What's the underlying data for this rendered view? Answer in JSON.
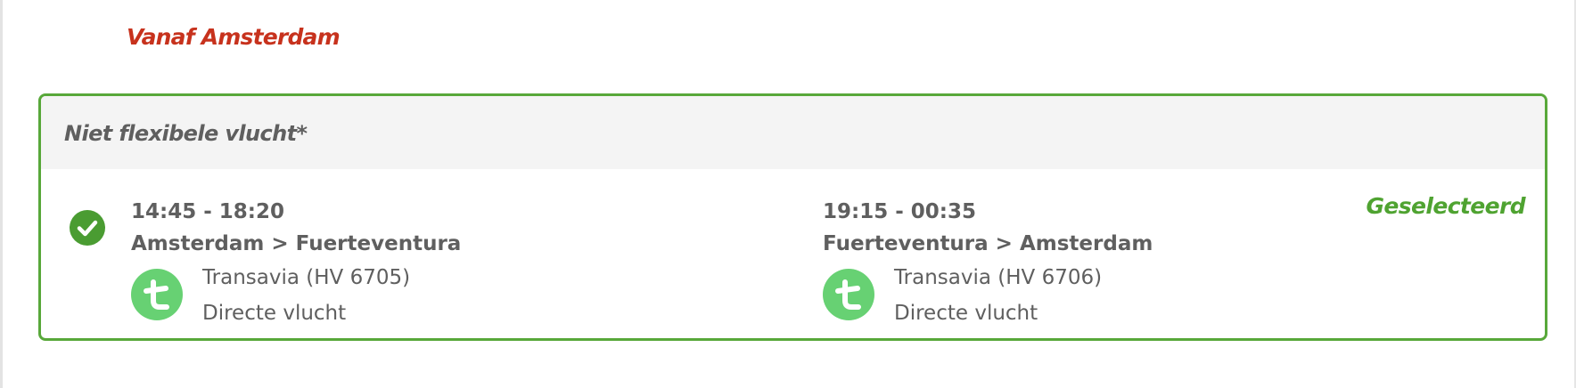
{
  "section": {
    "title": "Vanaf Amsterdam"
  },
  "option": {
    "header_title": "Niet flexibele vlucht*",
    "status_label": "Geselecteerd",
    "selected": true,
    "outbound": {
      "times": "14:45 - 18:20",
      "route": "Amsterdam > Fuerteventura",
      "carrier": "Transavia (HV 6705)",
      "type": "Directe vlucht",
      "logo_icon": "transavia-logo-icon"
    },
    "return": {
      "times": "19:15 - 00:35",
      "route": "Fuerteventura > Amsterdam",
      "carrier": "Transavia (HV 6706)",
      "type": "Directe vlucht",
      "logo_icon": "transavia-logo-icon"
    }
  },
  "colors": {
    "title_red": "#c7321d",
    "selected_green": "#58a83a",
    "carrier_green": "#67d173",
    "text_gray": "#5f5f5f",
    "header_bg": "#f4f4f4"
  }
}
